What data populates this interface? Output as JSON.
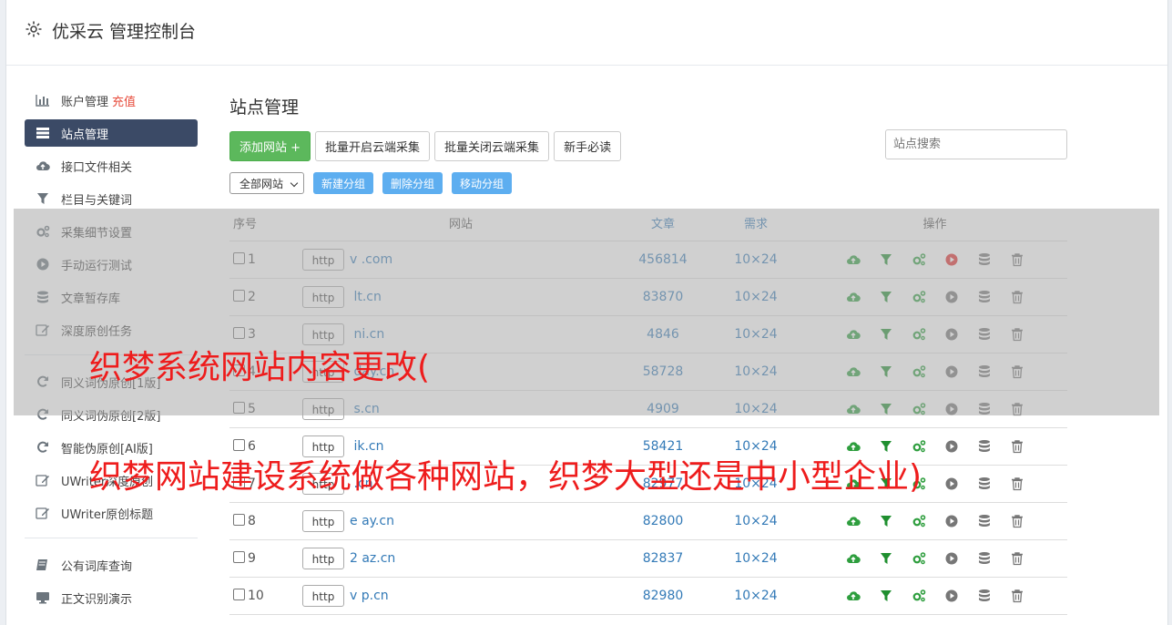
{
  "header": {
    "title": "优采云 管理控制台"
  },
  "sidebar": {
    "account": {
      "label": "账户管理",
      "recharge": "充值"
    },
    "items_a": [
      {
        "label": "站点管理",
        "icon": "server-icon",
        "active": true
      },
      {
        "label": "接口文件相关",
        "icon": "cloud-upload-icon"
      },
      {
        "label": "栏目与关键词",
        "icon": "filter-icon"
      },
      {
        "label": "采集细节设置",
        "icon": "cogs-icon"
      },
      {
        "label": "手动运行测试",
        "icon": "play-icon"
      },
      {
        "label": "文章暂存库",
        "icon": "database-icon"
      },
      {
        "label": "深度原创任务",
        "icon": "edit-icon"
      }
    ],
    "items_b": [
      {
        "label": "同义词伪原创[1版]",
        "icon": "refresh-icon"
      },
      {
        "label": "同义词伪原创[2版]",
        "icon": "refresh-icon"
      },
      {
        "label": "智能伪原创[AI版]",
        "icon": "refresh-icon"
      },
      {
        "label": "UWriter深度原创",
        "icon": "edit-icon"
      },
      {
        "label": "UWriter原创标题",
        "icon": "edit-icon"
      }
    ],
    "items_c": [
      {
        "label": "公有词库查询",
        "icon": "book-icon"
      },
      {
        "label": "正文识别演示",
        "icon": "desktop-icon"
      }
    ]
  },
  "main": {
    "title": "站点管理",
    "buttons": {
      "add": "添加网站 +",
      "batch_on": "批量开启云端采集",
      "batch_off": "批量关闭云端采集",
      "guide": "新手必读"
    },
    "search_placeholder": "站点搜索",
    "group_select": "全部网站",
    "group_buttons": {
      "new": "新建分组",
      "delete": "删除分组",
      "move": "移动分组"
    },
    "table": {
      "headers": {
        "num": "序号",
        "site": "网站",
        "articles": "文章",
        "demand": "需求",
        "ops": "操作"
      },
      "http_label": "http",
      "rows": [
        {
          "num": "1",
          "domain": "v          .com",
          "articles": "456814",
          "demand": "10×24",
          "running": true
        },
        {
          "num": "2",
          "domain": "        lt.cn",
          "articles": "83870",
          "demand": "10×24"
        },
        {
          "num": "3",
          "domain": "        ni.cn",
          "articles": "4846",
          "demand": "10×24"
        },
        {
          "num": "4",
          "domain": "        day.cn",
          "articles": "58728",
          "demand": "10×24"
        },
        {
          "num": "5",
          "domain": "        s.cn",
          "articles": "4909",
          "demand": "10×24"
        },
        {
          "num": "6",
          "domain": "        ik.cn",
          "articles": "58421",
          "demand": "10×24"
        },
        {
          "num": "7",
          "domain": "        .cn",
          "articles": "82977",
          "demand": "10×24"
        },
        {
          "num": "8",
          "domain": "e     ay.cn",
          "articles": "82800",
          "demand": "10×24"
        },
        {
          "num": "9",
          "domain": "2     az.cn",
          "articles": "82837",
          "demand": "10×24"
        },
        {
          "num": "10",
          "domain": "v     p.cn",
          "articles": "82980",
          "demand": "10×24"
        }
      ]
    }
  },
  "watermark": {
    "line1": "织梦系统网站内容更改(",
    "line2": "织梦网站建设系统做各种网站，织梦大型还是中小型企业)"
  },
  "colors": {
    "accent_green": "#5cb85c",
    "sidebar_active": "#3b4a66",
    "link_blue": "#337ab7",
    "watermark_red": "#ee1c1c"
  }
}
